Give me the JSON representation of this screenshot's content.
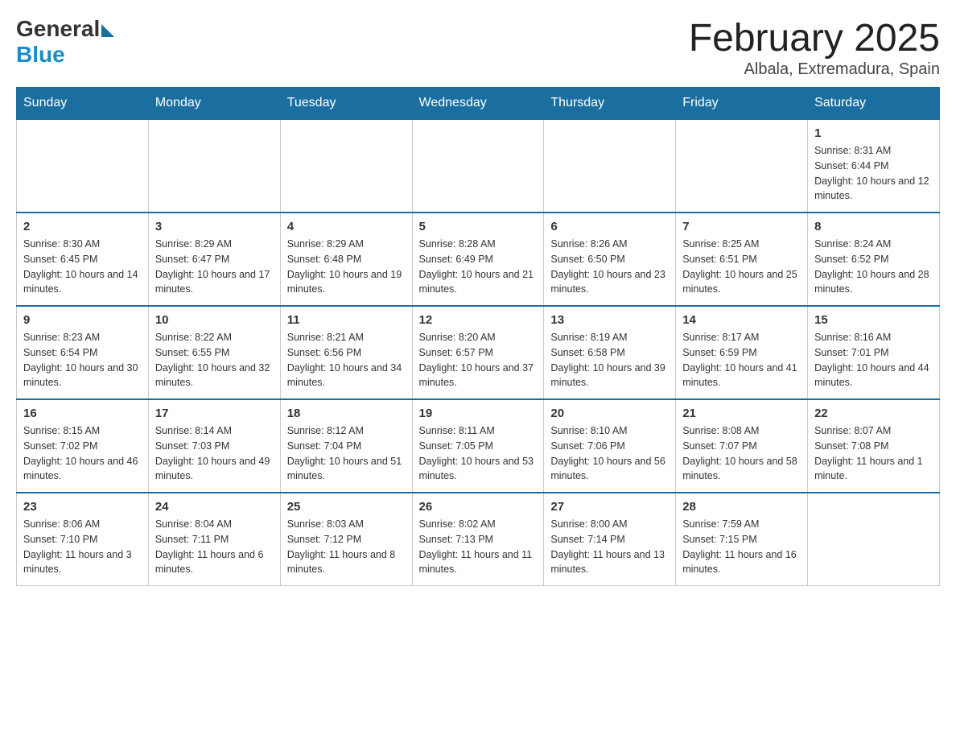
{
  "header": {
    "logo": {
      "general": "General",
      "blue": "Blue"
    },
    "title": "February 2025",
    "location": "Albala, Extremadura, Spain"
  },
  "weekdays": [
    "Sunday",
    "Monday",
    "Tuesday",
    "Wednesday",
    "Thursday",
    "Friday",
    "Saturday"
  ],
  "weeks": [
    [
      {
        "day": "",
        "sunrise": "",
        "sunset": "",
        "daylight": ""
      },
      {
        "day": "",
        "sunrise": "",
        "sunset": "",
        "daylight": ""
      },
      {
        "day": "",
        "sunrise": "",
        "sunset": "",
        "daylight": ""
      },
      {
        "day": "",
        "sunrise": "",
        "sunset": "",
        "daylight": ""
      },
      {
        "day": "",
        "sunrise": "",
        "sunset": "",
        "daylight": ""
      },
      {
        "day": "",
        "sunrise": "",
        "sunset": "",
        "daylight": ""
      },
      {
        "day": "1",
        "sunrise": "Sunrise: 8:31 AM",
        "sunset": "Sunset: 6:44 PM",
        "daylight": "Daylight: 10 hours and 12 minutes."
      }
    ],
    [
      {
        "day": "2",
        "sunrise": "Sunrise: 8:30 AM",
        "sunset": "Sunset: 6:45 PM",
        "daylight": "Daylight: 10 hours and 14 minutes."
      },
      {
        "day": "3",
        "sunrise": "Sunrise: 8:29 AM",
        "sunset": "Sunset: 6:47 PM",
        "daylight": "Daylight: 10 hours and 17 minutes."
      },
      {
        "day": "4",
        "sunrise": "Sunrise: 8:29 AM",
        "sunset": "Sunset: 6:48 PM",
        "daylight": "Daylight: 10 hours and 19 minutes."
      },
      {
        "day": "5",
        "sunrise": "Sunrise: 8:28 AM",
        "sunset": "Sunset: 6:49 PM",
        "daylight": "Daylight: 10 hours and 21 minutes."
      },
      {
        "day": "6",
        "sunrise": "Sunrise: 8:26 AM",
        "sunset": "Sunset: 6:50 PM",
        "daylight": "Daylight: 10 hours and 23 minutes."
      },
      {
        "day": "7",
        "sunrise": "Sunrise: 8:25 AM",
        "sunset": "Sunset: 6:51 PM",
        "daylight": "Daylight: 10 hours and 25 minutes."
      },
      {
        "day": "8",
        "sunrise": "Sunrise: 8:24 AM",
        "sunset": "Sunset: 6:52 PM",
        "daylight": "Daylight: 10 hours and 28 minutes."
      }
    ],
    [
      {
        "day": "9",
        "sunrise": "Sunrise: 8:23 AM",
        "sunset": "Sunset: 6:54 PM",
        "daylight": "Daylight: 10 hours and 30 minutes."
      },
      {
        "day": "10",
        "sunrise": "Sunrise: 8:22 AM",
        "sunset": "Sunset: 6:55 PM",
        "daylight": "Daylight: 10 hours and 32 minutes."
      },
      {
        "day": "11",
        "sunrise": "Sunrise: 8:21 AM",
        "sunset": "Sunset: 6:56 PM",
        "daylight": "Daylight: 10 hours and 34 minutes."
      },
      {
        "day": "12",
        "sunrise": "Sunrise: 8:20 AM",
        "sunset": "Sunset: 6:57 PM",
        "daylight": "Daylight: 10 hours and 37 minutes."
      },
      {
        "day": "13",
        "sunrise": "Sunrise: 8:19 AM",
        "sunset": "Sunset: 6:58 PM",
        "daylight": "Daylight: 10 hours and 39 minutes."
      },
      {
        "day": "14",
        "sunrise": "Sunrise: 8:17 AM",
        "sunset": "Sunset: 6:59 PM",
        "daylight": "Daylight: 10 hours and 41 minutes."
      },
      {
        "day": "15",
        "sunrise": "Sunrise: 8:16 AM",
        "sunset": "Sunset: 7:01 PM",
        "daylight": "Daylight: 10 hours and 44 minutes."
      }
    ],
    [
      {
        "day": "16",
        "sunrise": "Sunrise: 8:15 AM",
        "sunset": "Sunset: 7:02 PM",
        "daylight": "Daylight: 10 hours and 46 minutes."
      },
      {
        "day": "17",
        "sunrise": "Sunrise: 8:14 AM",
        "sunset": "Sunset: 7:03 PM",
        "daylight": "Daylight: 10 hours and 49 minutes."
      },
      {
        "day": "18",
        "sunrise": "Sunrise: 8:12 AM",
        "sunset": "Sunset: 7:04 PM",
        "daylight": "Daylight: 10 hours and 51 minutes."
      },
      {
        "day": "19",
        "sunrise": "Sunrise: 8:11 AM",
        "sunset": "Sunset: 7:05 PM",
        "daylight": "Daylight: 10 hours and 53 minutes."
      },
      {
        "day": "20",
        "sunrise": "Sunrise: 8:10 AM",
        "sunset": "Sunset: 7:06 PM",
        "daylight": "Daylight: 10 hours and 56 minutes."
      },
      {
        "day": "21",
        "sunrise": "Sunrise: 8:08 AM",
        "sunset": "Sunset: 7:07 PM",
        "daylight": "Daylight: 10 hours and 58 minutes."
      },
      {
        "day": "22",
        "sunrise": "Sunrise: 8:07 AM",
        "sunset": "Sunset: 7:08 PM",
        "daylight": "Daylight: 11 hours and 1 minute."
      }
    ],
    [
      {
        "day": "23",
        "sunrise": "Sunrise: 8:06 AM",
        "sunset": "Sunset: 7:10 PM",
        "daylight": "Daylight: 11 hours and 3 minutes."
      },
      {
        "day": "24",
        "sunrise": "Sunrise: 8:04 AM",
        "sunset": "Sunset: 7:11 PM",
        "daylight": "Daylight: 11 hours and 6 minutes."
      },
      {
        "day": "25",
        "sunrise": "Sunrise: 8:03 AM",
        "sunset": "Sunset: 7:12 PM",
        "daylight": "Daylight: 11 hours and 8 minutes."
      },
      {
        "day": "26",
        "sunrise": "Sunrise: 8:02 AM",
        "sunset": "Sunset: 7:13 PM",
        "daylight": "Daylight: 11 hours and 11 minutes."
      },
      {
        "day": "27",
        "sunrise": "Sunrise: 8:00 AM",
        "sunset": "Sunset: 7:14 PM",
        "daylight": "Daylight: 11 hours and 13 minutes."
      },
      {
        "day": "28",
        "sunrise": "Sunrise: 7:59 AM",
        "sunset": "Sunset: 7:15 PM",
        "daylight": "Daylight: 11 hours and 16 minutes."
      },
      {
        "day": "",
        "sunrise": "",
        "sunset": "",
        "daylight": ""
      }
    ]
  ]
}
